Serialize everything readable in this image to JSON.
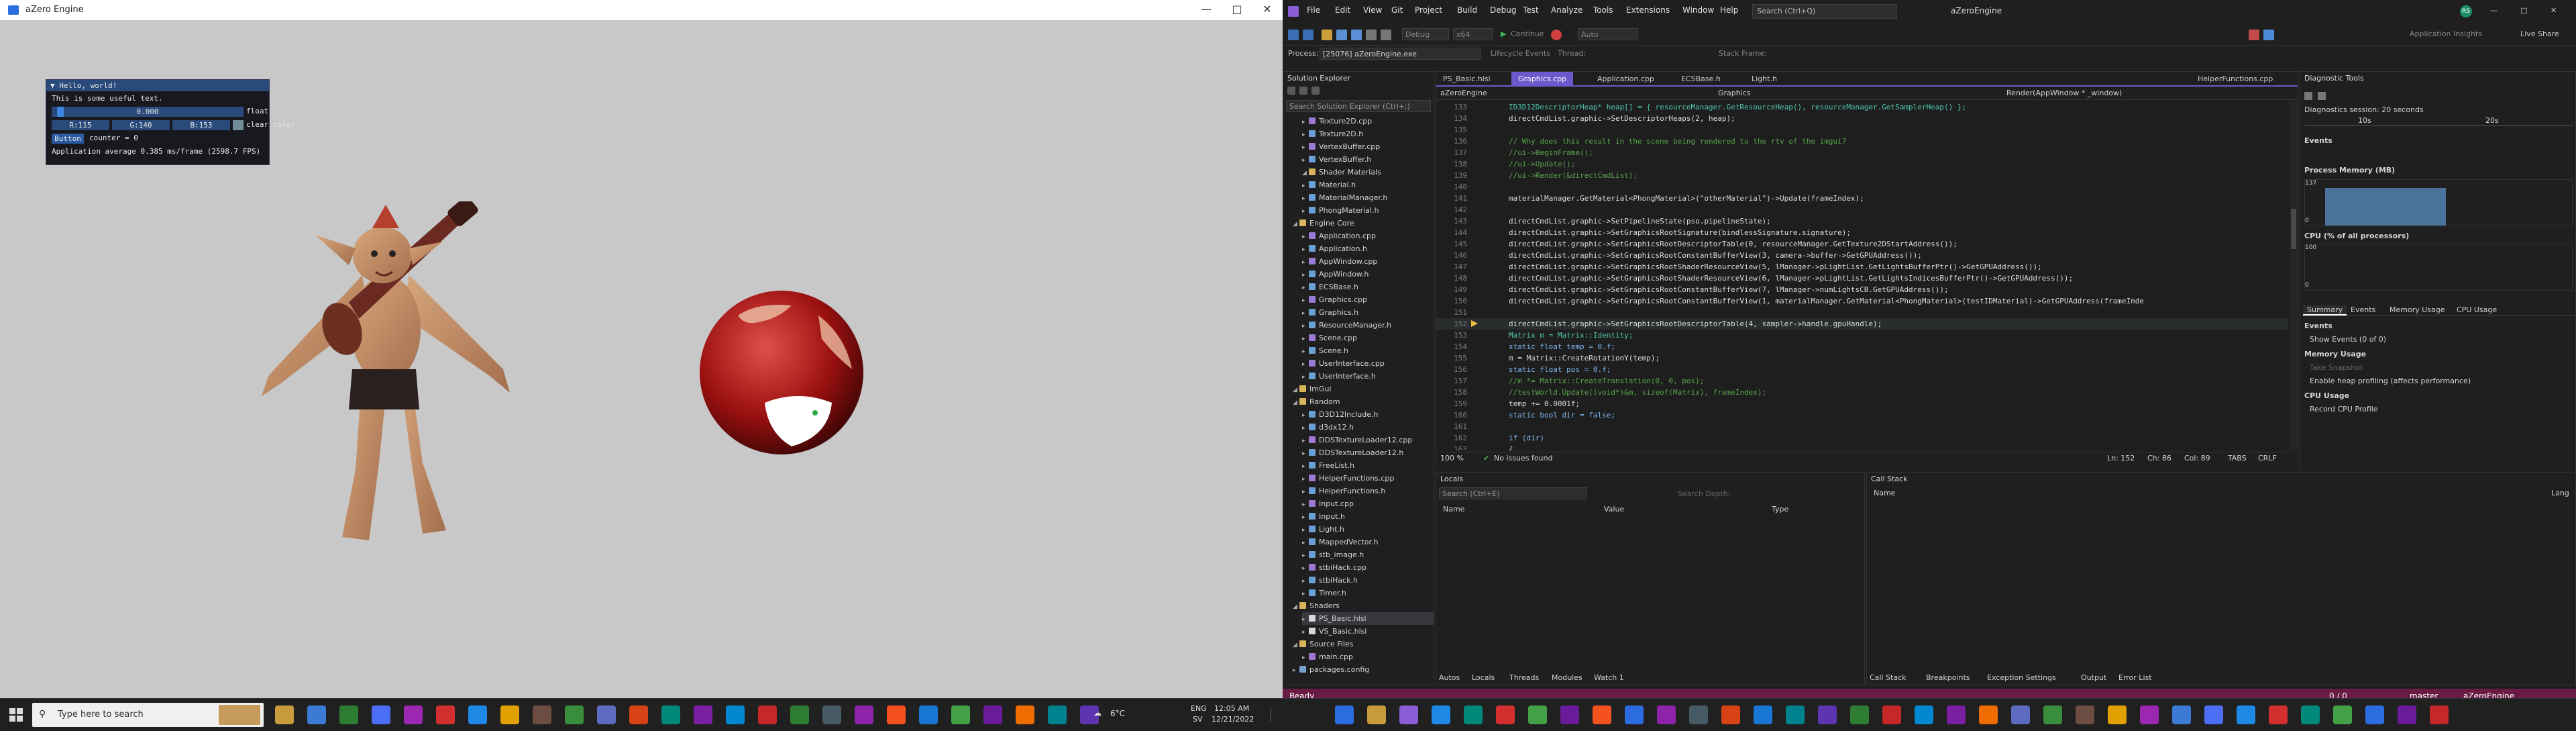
{
  "game": {
    "title": "aZero Engine",
    "imgui": {
      "title": "Hello, world!",
      "text": "This is some useful text.",
      "slider_value": "0.000",
      "slider_label": "float",
      "r": "R:115",
      "g": "G:140",
      "b": "B:153",
      "clear_label": "clear color",
      "button": "Button",
      "counter": "counter = 0",
      "fps": "Application average 0.385 ms/frame (2598.7 FPS)"
    }
  },
  "vs": {
    "menus": [
      "File",
      "Edit",
      "View",
      "Git",
      "Project",
      "Build",
      "Debug",
      "Test",
      "Analyze",
      "Tools",
      "Extensions",
      "Window",
      "Help"
    ],
    "search": "Search (Ctrl+Q)",
    "app_name": "aZeroEngine",
    "live_share": "Live Share",
    "toolbar": {
      "continue": "Continue",
      "debug": "Debug",
      "platform": "x64",
      "auto": "Auto",
      "insights": "Application Insights"
    },
    "process_label": "Process:",
    "process": "[25076] aZeroEngine.exe",
    "lifecycle": "Lifecycle Events",
    "thread": "Thread:",
    "stack": "Stack Frame:",
    "solution_explorer": {
      "title": "Solution Explorer",
      "search": "Search Solution Explorer (Ctrl+;)",
      "items": [
        "Texture2D.cpp",
        "Texture2D.h",
        "VertexBuffer.cpp",
        "VertexBuffer.h",
        "Shader Materials",
        "Material.h",
        "MaterialManager.h",
        "PhongMaterial.h",
        "Engine Core",
        "Application.cpp",
        "Application.h",
        "AppWindow.cpp",
        "AppWindow.h",
        "ECSBase.h",
        "Graphics.cpp",
        "Graphics.h",
        "ResourceManager.h",
        "Scene.cpp",
        "Scene.h",
        "UserInterface.cpp",
        "UserInterface.h",
        "ImGui",
        "Random",
        "D3D12Include.h",
        "d3dx12.h",
        "DDSTextureLoader12.cpp",
        "DDSTextureLoader12.h",
        "FreeList.h",
        "HelperFunctions.cpp",
        "HelperFunctions.h",
        "Input.cpp",
        "Input.h",
        "Light.h",
        "MappedVector.h",
        "stb_image.h",
        "stbiHack.cpp",
        "stbiHack.h",
        "Timer.h",
        "Shaders",
        "PS_Basic.hlsl",
        "VS_Basic.hlsl",
        "Source Files",
        "main.cpp",
        "packages.config"
      ]
    },
    "tabs": [
      "PS_Basic.hlsl",
      "Graphics.cpp",
      "Application.cpp",
      "ECSBase.h",
      "Light.h",
      "HelperFunctions.cpp"
    ],
    "nav": {
      "project": "aZeroEngine",
      "scope": "Graphics",
      "member": "Render(AppWindow * _window)"
    },
    "code": [
      {
        "n": "133",
        "t": "ID3D12DescriptorHeap* heap[] = { resourceManager.GetResourceHeap(), resourceManager.GetSamplerHeap() };"
      },
      {
        "n": "134",
        "t": "directCmdList.graphic->SetDescriptorHeaps(2, heap);"
      },
      {
        "n": "135",
        "t": ""
      },
      {
        "n": "136",
        "t": "// Why does this result in the scene being rendered to the rtv of the imgui?"
      },
      {
        "n": "137",
        "t": "//ui->BeginFrame();"
      },
      {
        "n": "138",
        "t": "//ui->Update();"
      },
      {
        "n": "139",
        "t": "//ui->Render(&directCmdList);"
      },
      {
        "n": "140",
        "t": ""
      },
      {
        "n": "141",
        "t": "materialManager.GetMaterial<PhongMaterial>(\"otherMaterial\")->Update(frameIndex);"
      },
      {
        "n": "142",
        "t": ""
      },
      {
        "n": "143",
        "t": "directCmdList.graphic->SetPipelineState(pso.pipelineState);"
      },
      {
        "n": "144",
        "t": "directCmdList.graphic->SetGraphicsRootSignature(bindlessSignature.signature);"
      },
      {
        "n": "145",
        "t": "directCmdList.graphic->SetGraphicsRootDescriptorTable(0, resourceManager.GetTexture2DStartAddress());"
      },
      {
        "n": "146",
        "t": "directCmdList.graphic->SetGraphicsRootConstantBufferView(3, camera->buffer->GetGPUAddress());"
      },
      {
        "n": "147",
        "t": "directCmdList.graphic->SetGraphicsRootShaderResourceView(5, lManager->pLightList.GetLightsBufferPtr()->GetGPUAddress());"
      },
      {
        "n": "148",
        "t": "directCmdList.graphic->SetGraphicsRootShaderResourceView(6, lManager->pLightList.GetLightsIndicesBufferPtr()->GetGPUAddress());"
      },
      {
        "n": "149",
        "t": "directCmdList.graphic->SetGraphicsRootConstantBufferView(7, lManager->numLightsCB.GetGPUAddress());"
      },
      {
        "n": "150",
        "t": "directCmdList.graphic->SetGraphicsRootConstantBufferView(1, materialManager.GetMaterial<PhongMaterial>(testIDMaterial)->GetGPUAddress(frameInde"
      },
      {
        "n": "151",
        "t": ""
      },
      {
        "n": "152",
        "t": "directCmdList.graphic->SetGraphicsRootDescriptorTable(4, sampler->handle.gpuHandle);"
      },
      {
        "n": "153",
        "t": "Matrix m = Matrix::Identity;"
      },
      {
        "n": "154",
        "t": "static float temp = 0.f;"
      },
      {
        "n": "155",
        "t": "m = Matrix::CreateRotationY(temp);"
      },
      {
        "n": "156",
        "t": "static float pos = 0.f;"
      },
      {
        "n": "157",
        "t": "//m *= Matrix::CreateTranslation(0, 0, pos);"
      },
      {
        "n": "158",
        "t": "//testWorld.Update((void*)&m, sizeof(Matrix), frameIndex);"
      },
      {
        "n": "159",
        "t": "temp += 0.0001f;"
      },
      {
        "n": "160",
        "t": "static bool dir = false;"
      },
      {
        "n": "161",
        "t": ""
      },
      {
        "n": "162",
        "t": "if (dir)"
      },
      {
        "n": "163",
        "t": "{"
      }
    ],
    "editor_status": {
      "zoom": "100 %",
      "issues": "No issues found",
      "ln": "Ln: 152",
      "ch": "Ch: 86",
      "col": "Col: 89",
      "tabs": "TABS",
      "crlf": "CRLF"
    },
    "diagnostics": {
      "title": "Diagnostic Tools",
      "session": "Diagnostics session: 20 seconds",
      "t10": "10s",
      "t20": "20s",
      "events": "Events",
      "process_memory": "Process Memory (MB)",
      "mem_max": "137",
      "mem_min": "0",
      "cpu": "CPU (% of all processors)",
      "cpu_max": "100",
      "cpu_min": "0",
      "tabs": [
        "Summary",
        "Events",
        "Memory Usage",
        "CPU Usage"
      ],
      "events_h": "Events",
      "show_events": "Show Events (0 of 0)",
      "memory_usage": "Memory Usage",
      "take_snapshot": "Take Snapshot",
      "heap_profiling": "Enable heap profiling (affects performance)",
      "cpu_usage": "CPU Usage",
      "record_cpu": "Record CPU Profile"
    },
    "locals": {
      "title": "Locals",
      "search": "Search (Ctrl+E)",
      "depth": "Search Depth:",
      "cols": [
        "Name",
        "Value",
        "Type"
      ],
      "tabs": [
        "Autos",
        "Locals",
        "Threads",
        "Modules",
        "Watch 1"
      ]
    },
    "callstack": {
      "title": "Call Stack",
      "cols": [
        "Name",
        "Lang"
      ],
      "tabs": [
        "Call Stack",
        "Breakpoints",
        "Exception Settings",
        "Output",
        "Error List"
      ]
    },
    "status": {
      "ready": "Ready",
      "errors": "0 / 0",
      "branch": "master",
      "repo": "aZeroEngine"
    }
  },
  "taskbar": {
    "search": "Type here to search",
    "weather": "6°C",
    "lang1": "ENG",
    "lang2": "SV",
    "time": "12:05 AM",
    "date": "12/21/2022"
  }
}
